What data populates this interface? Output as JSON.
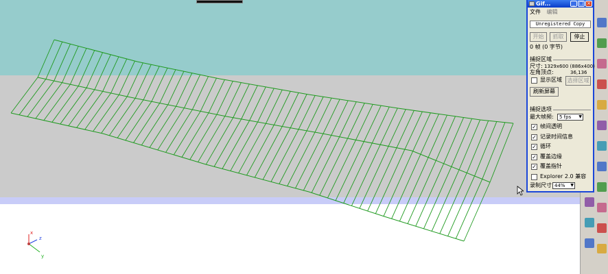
{
  "gif_window": {
    "title": "Gif...",
    "menu": {
      "file": "文件",
      "edit": "编辑"
    },
    "unregistered": "Unregistered Copy",
    "buttons": {
      "start": "开始",
      "capture": "抓取",
      "stop": "停止"
    },
    "frame_count": "0 帧 (0 字节)",
    "capture_area": {
      "section_label": "捕捉区域",
      "size_label": "尺寸:",
      "size_value": "1329x600 (886x400)",
      "topleft_label": "左角顶点:",
      "topleft_value": "36,136",
      "show_area_label": "显示区域",
      "show_area_checked": false,
      "select_area_button": "选择区域",
      "refresh_button": "刷新屏幕"
    },
    "capture_options": {
      "section_label": "捕捉选项",
      "max_fps_label": "最大帧频:",
      "max_fps_value": "5 fps",
      "options": [
        {
          "label": "帧间透明",
          "checked": true
        },
        {
          "label": "记录时间信息",
          "checked": true
        },
        {
          "label": "循环",
          "checked": true
        },
        {
          "label": "覆盖边缘",
          "checked": true
        },
        {
          "label": "覆盖指针",
          "checked": true
        },
        {
          "label": "Explorer 2.0 兼容",
          "checked": false
        }
      ],
      "record_size_label": "录制尺寸",
      "record_size_value": "44%"
    }
  },
  "axis_labels": {
    "x": "x",
    "y": "y",
    "z": "z"
  },
  "colors": {
    "mesh": "#1f9a1f",
    "titlebar": "#1a46d8",
    "sky": "#96cccc",
    "ground": "#cbcbcb"
  }
}
